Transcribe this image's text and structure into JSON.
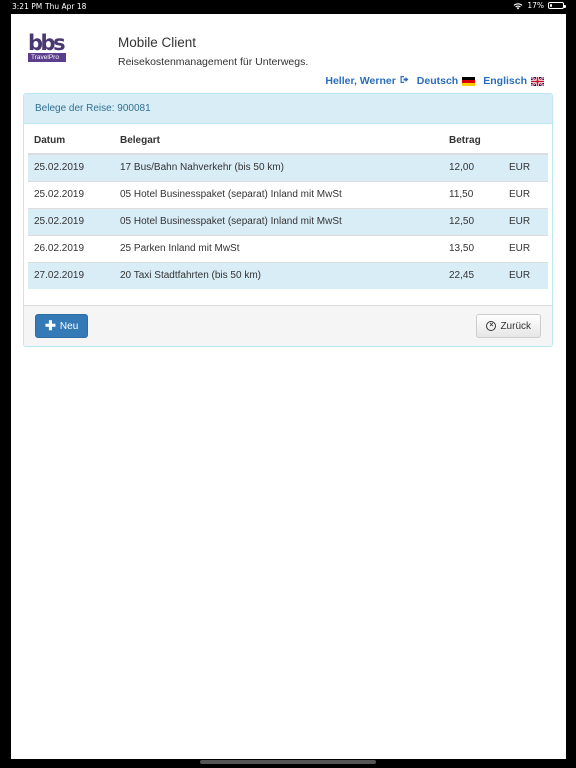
{
  "statusbar": {
    "time": "3:21 PM",
    "date": "Thu Apr 18",
    "battery": "17%"
  },
  "logo": {
    "text": "bbs",
    "sub": "TravelPro"
  },
  "app": {
    "title": "Mobile Client",
    "subtitle": "Reisekostenmanagement für Unterwegs."
  },
  "nav": {
    "user": "Heller, Werner",
    "lang_de": "Deutsch",
    "lang_en": "Englisch"
  },
  "panel": {
    "heading": "Belege der Reise: 900081",
    "columns": [
      "Datum",
      "Belegart",
      "Betrag",
      ""
    ],
    "rows": [
      [
        "25.02.2019",
        "17 Bus/Bahn Nahverkehr (bis 50 km)",
        "12,00",
        "EUR"
      ],
      [
        "25.02.2019",
        "05 Hotel Businesspaket (separat) Inland mit MwSt",
        "11,50",
        "EUR"
      ],
      [
        "25.02.2019",
        "05 Hotel Businesspaket (separat) Inland mit MwSt",
        "12,50",
        "EUR"
      ],
      [
        "26.02.2019",
        "25 Parken Inland mit MwSt",
        "13,50",
        "EUR"
      ],
      [
        "27.02.2019",
        "20 Taxi Stadtfahrten (bis 50 km)",
        "22,45",
        "EUR"
      ]
    ]
  },
  "buttons": {
    "new": "Neu",
    "back": "Zurück"
  },
  "colors": {
    "primary": "#337ab7",
    "info_bg": "#d9edf7",
    "link": "#2a6ebb"
  }
}
